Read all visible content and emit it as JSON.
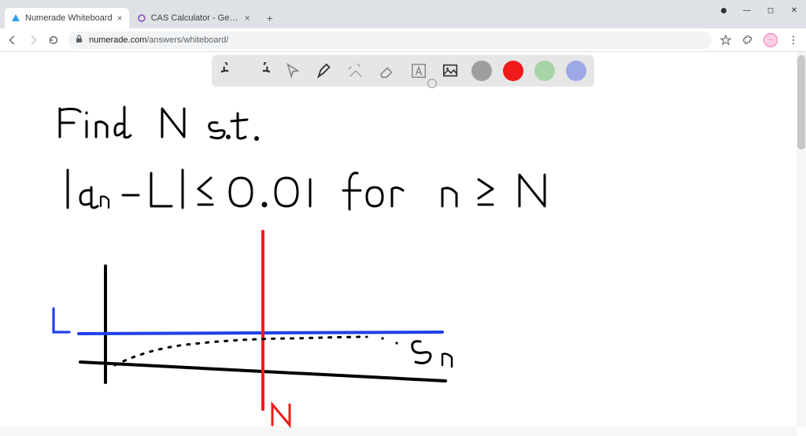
{
  "browser": {
    "tabs": [
      {
        "title": "Numerade Whiteboard",
        "active": true
      },
      {
        "title": "CAS Calculator - GeoGebra",
        "active": false
      }
    ],
    "url_domain": "numerade.com",
    "url_path": "/answers/whiteboard/",
    "window_controls": {
      "minimize": "—",
      "maximize": "◻",
      "close": "✕"
    }
  },
  "toolbar": {
    "tools": [
      "undo",
      "redo",
      "pointer",
      "pen",
      "tools",
      "eraser",
      "text",
      "image"
    ],
    "colors": [
      "gray",
      "red",
      "green",
      "blue"
    ],
    "selected_color": "red"
  },
  "whiteboard": {
    "text_line1": "Find N s.t.",
    "text_line2": "|aₙ - L| ≤ 0.01  for  n ≥ N",
    "label_L": "L",
    "label_N": "N",
    "label_Sn": "Sₙ"
  }
}
